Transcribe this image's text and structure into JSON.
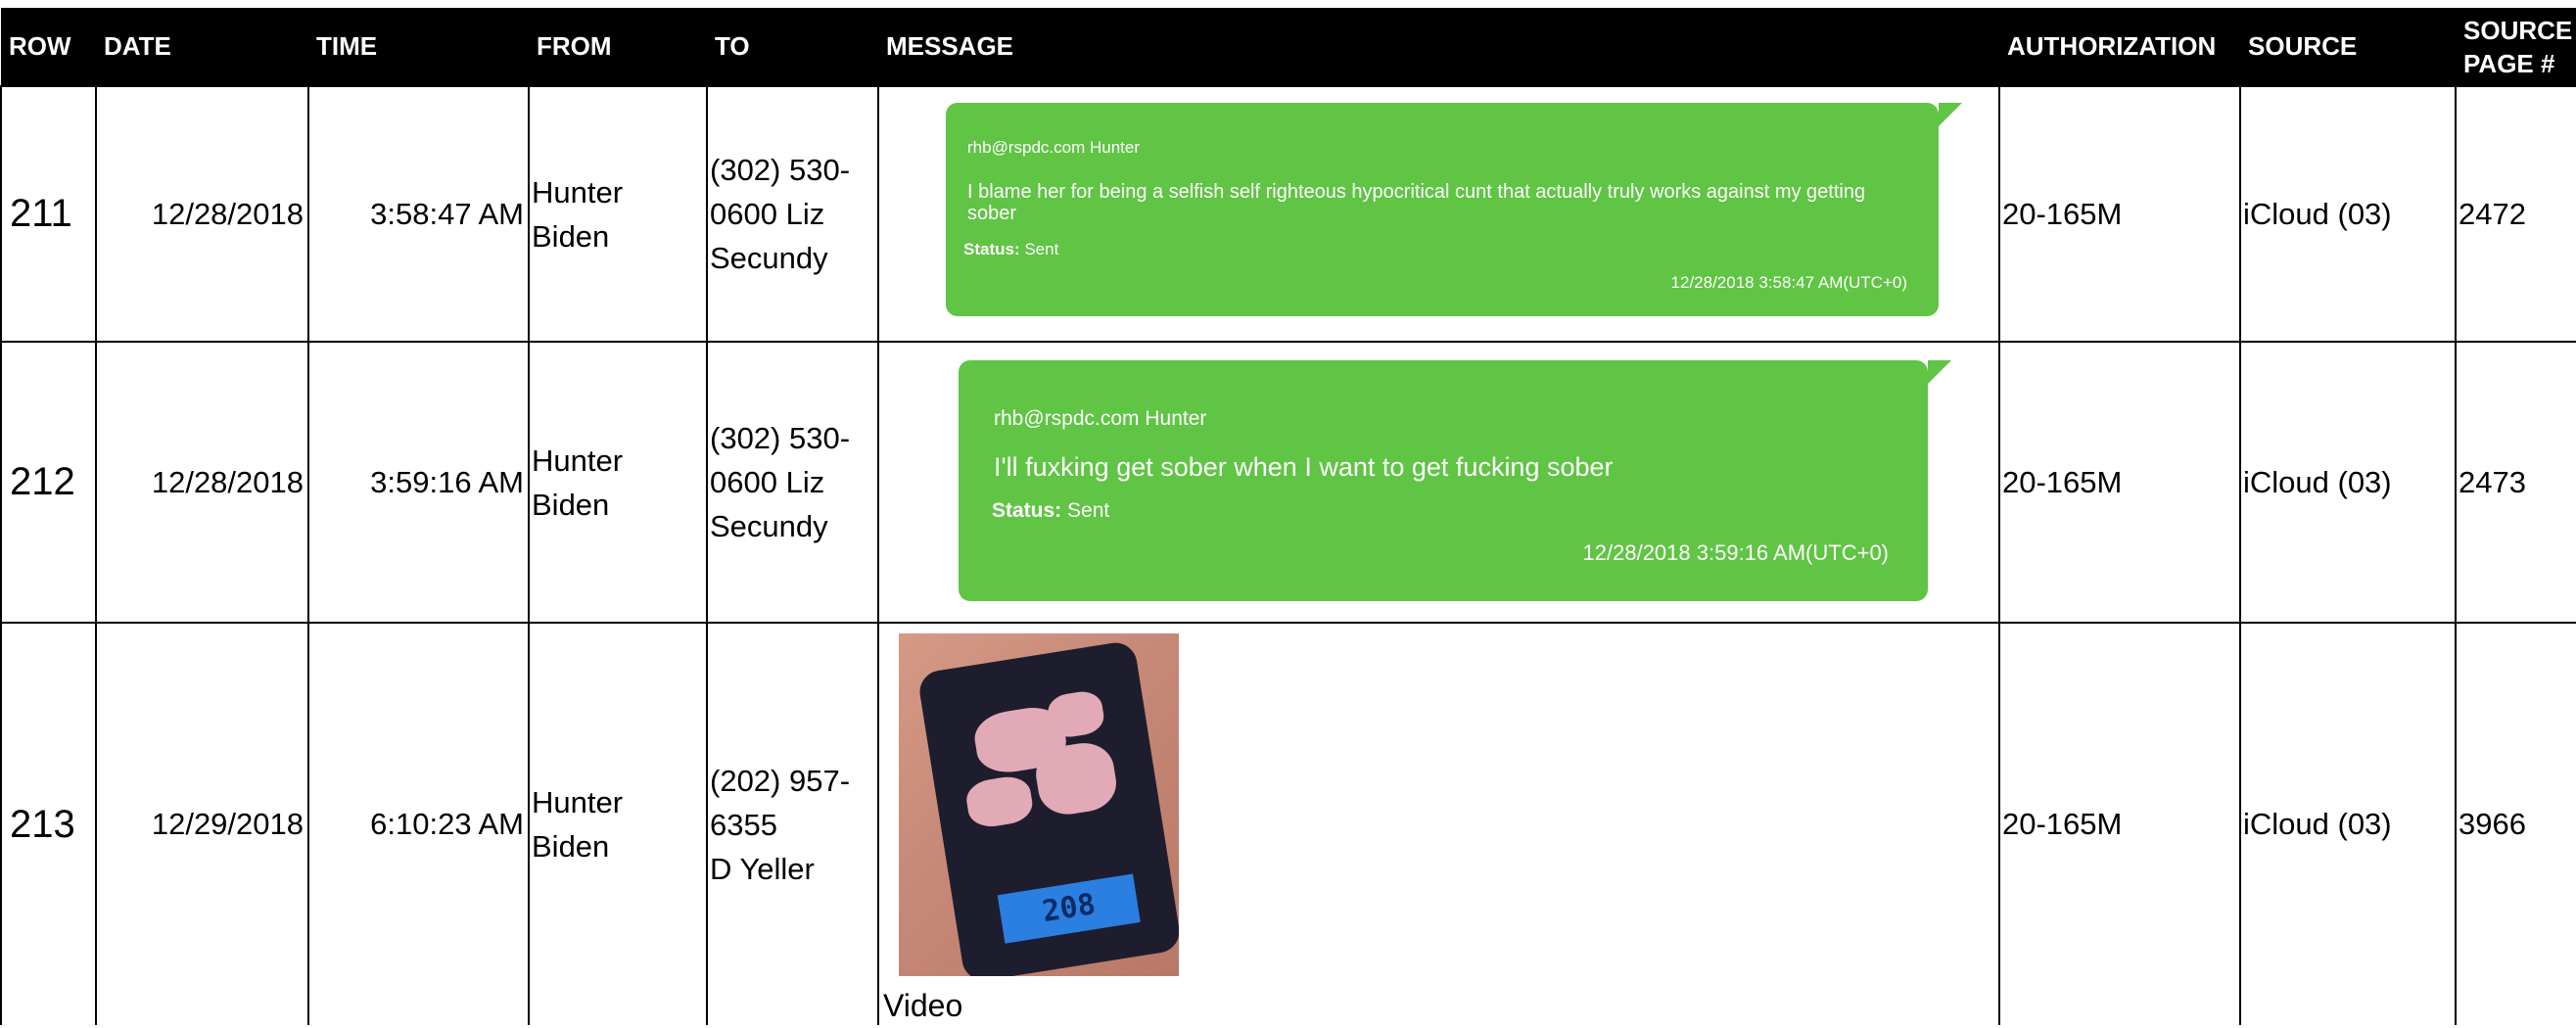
{
  "headers": {
    "row": "ROW",
    "date": "DATE",
    "time": "TIME",
    "from": "FROM",
    "to": "TO",
    "message": "MESSAGE",
    "authorization": "AUTHORIZATION",
    "source": "SOURCE",
    "source_page_line1": "SOURCE",
    "source_page_line2": "PAGE #"
  },
  "rows": [
    {
      "row": "211",
      "date": "12/28/2018",
      "time": "3:58:47 AM",
      "from_line1": "Hunter",
      "from_line2": "Biden",
      "to_line1": "(302) 530-",
      "to_line2": "0600 Liz",
      "to_line3": "Secundy",
      "message": {
        "sender": "rhb@rspdc.com Hunter",
        "text": "I blame her for being a selfish self righteous hypocritical cunt that actually truly works against my getting sober",
        "status_label": "Status:",
        "status_value": " Sent",
        "timestamp": "12/28/2018 3:58:47 AM(UTC+0)"
      },
      "authorization": "20-165M",
      "source": "iCloud (03)",
      "source_page": "2472"
    },
    {
      "row": "212",
      "date": "12/28/2018",
      "time": "3:59:16 AM",
      "from_line1": "Hunter",
      "from_line2": "Biden",
      "to_line1": "(302) 530-",
      "to_line2": "0600 Liz",
      "to_line3": "Secundy",
      "message": {
        "sender": "rhb@rspdc.com Hunter",
        "text": "I'll fuxking get sober when I want to get fucking sober",
        "status_label": "Status:",
        "status_value": " Sent",
        "timestamp": "12/28/2018 3:59:16 AM(UTC+0)"
      },
      "authorization": "20-165M",
      "source": "iCloud (03)",
      "source_page": "2473"
    },
    {
      "row": "213",
      "date": "12/29/2018",
      "time": "6:10:23 AM",
      "from_line1": "Hunter",
      "from_line2": "Biden",
      "to_line1": "(202) 957-",
      "to_line2": "6355",
      "to_line3": "D Yeller",
      "message": {
        "scale_display": "208",
        "media_label": "Video"
      },
      "authorization": "20-165M",
      "source": "iCloud (03)",
      "source_page": "3966"
    }
  ],
  "colors": {
    "header_bg": "#000000",
    "bubble_green": "#60c444"
  }
}
